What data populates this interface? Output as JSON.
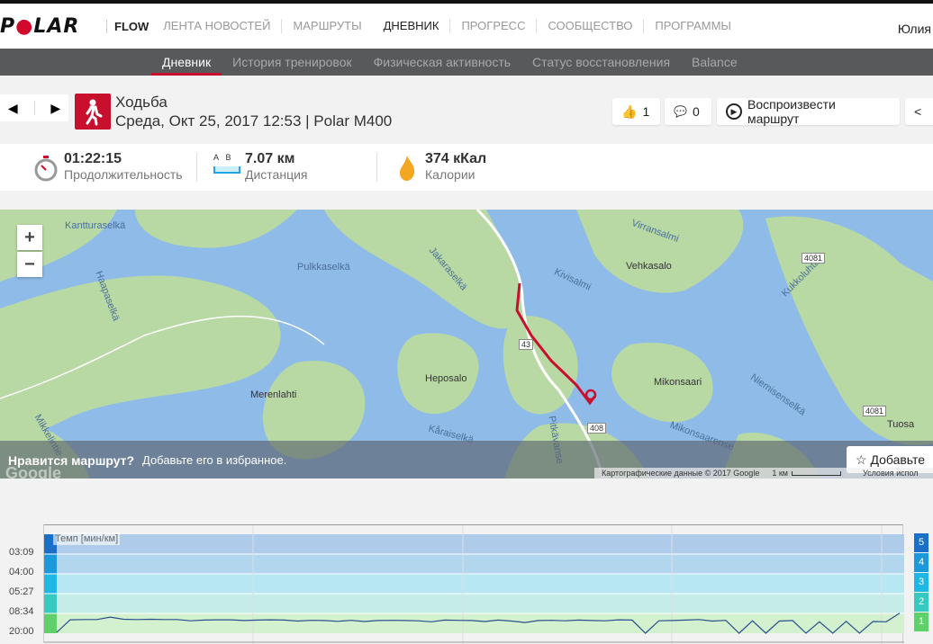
{
  "nav": {
    "logo": "POLAR",
    "flow": "FLOW",
    "items": [
      "ЛЕНТА НОВОСТЕЙ",
      "МАРШРУТЫ",
      "ДНЕВНИК",
      "ПРОГРЕСС",
      "СООБЩЕСТВО",
      "ПРОГРАММЫ"
    ],
    "active": "ДНЕВНИК",
    "user": "Юлия"
  },
  "subnav": {
    "items": [
      "Дневник",
      "История тренировок",
      "Физическая активность",
      "Статус восстановления",
      "Balance"
    ],
    "active": "Дневник"
  },
  "session": {
    "sport": "Ходьба",
    "details": "Среда, Окт 25, 2017 12:53 | Polar M400",
    "likes": "1",
    "comments": "0",
    "replay": "Воспроизвести маршрут"
  },
  "stats": [
    {
      "value": "01:22:15",
      "label": "Продолжительность",
      "icon": "stopwatch-icon"
    },
    {
      "value": "7.07 км",
      "label": "Дистанция",
      "icon": "distance-icon",
      "a": "A",
      "b": "B"
    },
    {
      "value": "374 кКал",
      "label": "Калории",
      "icon": "flame-icon"
    }
  ],
  "map": {
    "labels": [
      "Kantturaselkä",
      "Pulkkaselkä",
      "Haapaselkä",
      "Jakaraselkä",
      "Kivisalmi",
      "Virransalmi",
      "Vehkasalo",
      "Kukkoluhta",
      "Heposalo",
      "Merenlahti",
      "Mikonsaari",
      "Niemisenselkä",
      "Tuosa",
      "Mikonsaarense",
      "Kåraiselkä",
      "Pitkävanse",
      "Mikkelintie"
    ],
    "roads": [
      "408",
      "4081",
      "4081",
      "43"
    ],
    "prompt_bold": "Нравится маршрут?",
    "prompt": "Добавьте его в избранное.",
    "add": "Добавьте",
    "copyright": "Картографические данные © 2017 Google",
    "scale": "1 км",
    "terms": "Условия испол",
    "google": "Google",
    "zoom_in": "+",
    "zoom_out": "−"
  },
  "colors": {
    "accent": "#c8102e",
    "zone1": "#5fd06a",
    "zone2": "#36c9c2",
    "zone3": "#1fb8e6",
    "zone4": "#1c98dc",
    "zone5": "#1a6fc8",
    "line": "#2b4f8c"
  },
  "chart_data": {
    "type": "line",
    "title": "Темп [мин/км]",
    "yticks": [
      "03:09",
      "04:00",
      "05:27",
      "08:34",
      "20:00"
    ],
    "zones": [
      "1",
      "2",
      "3",
      "4",
      "5"
    ],
    "pace_min_per_km": [
      19,
      10.5,
      10.4,
      10.4,
      9.6,
      10.3,
      10.4,
      10.3,
      10.4,
      10.4,
      10.9,
      10.6,
      10.5,
      10.5,
      10.8,
      10.6,
      10.5,
      10.6,
      11.0,
      10.7,
      10.8,
      11.1,
      10.7,
      11.2,
      10.8,
      10.7,
      10.8,
      10.9,
      11.3,
      10.6,
      10.7,
      10.8,
      11.2,
      10.6,
      11.0,
      11.6,
      10.8,
      10.7,
      10.9,
      10.6,
      10.8,
      10.9,
      10.5,
      10.6,
      20,
      10.9,
      10.8,
      10.6,
      10.4,
      11.0,
      10.7,
      20,
      10.9,
      20,
      11.0,
      10.8,
      20,
      11.3,
      20,
      11.1,
      20,
      11.2,
      11.3,
      8.5
    ]
  }
}
